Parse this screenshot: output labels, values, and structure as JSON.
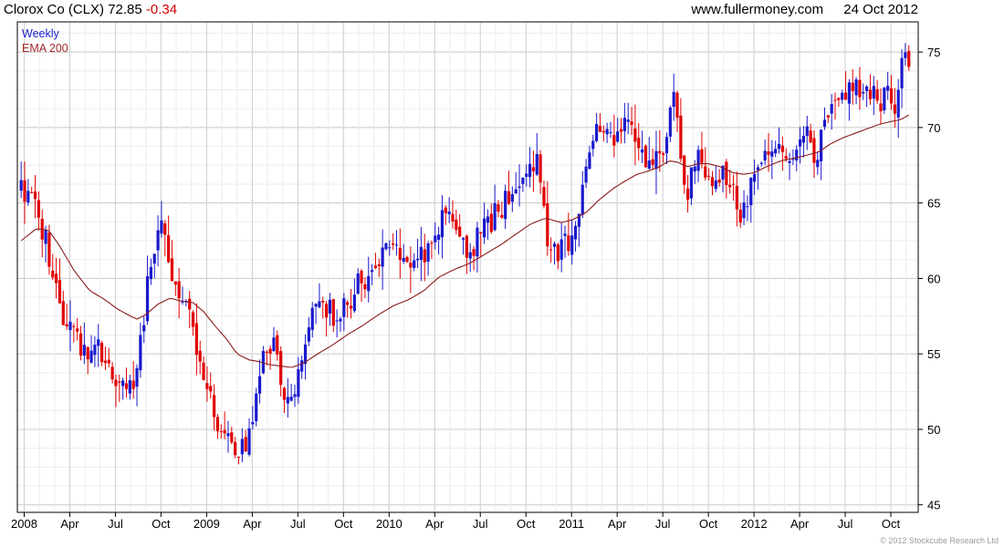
{
  "header": {
    "title": "Clorox Co (CLX) 72.85",
    "change": "-0.34",
    "site": "www.fullermoney.com",
    "date": "24 Oct 2012"
  },
  "legend": {
    "series": "Weekly",
    "indicator": "EMA 200"
  },
  "footer": {
    "copyright": "© 2012 Stockcube Research Ltd"
  },
  "colors": {
    "up": "#1a1acc",
    "down": "#e00000",
    "ema": "#8b1a1a",
    "grid": "#d8d8d8"
  },
  "chart_data": {
    "type": "candlestick",
    "title": "Clorox Co (CLX)",
    "ylim": [
      44.5,
      77
    ],
    "yticks": [
      45,
      50,
      55,
      60,
      65,
      70,
      75
    ],
    "xticks": [
      {
        "label": "2008",
        "t": 0.2
      },
      {
        "label": "Apr",
        "t": 3.2
      },
      {
        "label": "Jul",
        "t": 6.2
      },
      {
        "label": "Oct",
        "t": 9.2
      },
      {
        "label": "2009",
        "t": 12.2
      },
      {
        "label": "Apr",
        "t": 15.2
      },
      {
        "label": "Jul",
        "t": 18.2
      },
      {
        "label": "Oct",
        "t": 21.2
      },
      {
        "label": "2010",
        "t": 24.2
      },
      {
        "label": "Apr",
        "t": 27.2
      },
      {
        "label": "Jul",
        "t": 30.2
      },
      {
        "label": "Oct",
        "t": 33.2
      },
      {
        "label": "2011",
        "t": 36.2
      },
      {
        "label": "Apr",
        "t": 39.2
      },
      {
        "label": "Jul",
        "t": 42.2
      },
      {
        "label": "Oct",
        "t": 45.2
      },
      {
        "label": "2012",
        "t": 48.2
      },
      {
        "label": "Apr",
        "t": 51.2
      },
      {
        "label": "Jul",
        "t": 54.2
      },
      {
        "label": "Oct",
        "t": 57.2
      }
    ],
    "xlim": [
      -0.25,
      59.0
    ],
    "close_anchors": [
      [
        0,
        66.0
      ],
      [
        0.5,
        65.5
      ],
      [
        1,
        64.5
      ],
      [
        1.5,
        63.0
      ],
      [
        2.2,
        59.5
      ],
      [
        2.8,
        57.0
      ],
      [
        3.5,
        56.0
      ],
      [
        4.3,
        55.5
      ],
      [
        5,
        55.2
      ],
      [
        5.8,
        54.5
      ],
      [
        6.5,
        53.0
      ],
      [
        7,
        52.5
      ],
      [
        7.6,
        54.0
      ],
      [
        8.2,
        58.5
      ],
      [
        8.7,
        62.0
      ],
      [
        9.3,
        63.5
      ],
      [
        9.8,
        61.0
      ],
      [
        10.4,
        59.0
      ],
      [
        11,
        58.0
      ],
      [
        11.6,
        55.5
      ],
      [
        12.2,
        53.0
      ],
      [
        12.8,
        51.0
      ],
      [
        13.5,
        49.5
      ],
      [
        14.3,
        48.5
      ],
      [
        15,
        49.5
      ],
      [
        15.5,
        52.0
      ],
      [
        16,
        55.0
      ],
      [
        16.6,
        55.5
      ],
      [
        17.2,
        53.0
      ],
      [
        17.8,
        52.0
      ],
      [
        18.4,
        54.5
      ],
      [
        19,
        57.0
      ],
      [
        19.8,
        58.5
      ],
      [
        20.6,
        57.5
      ],
      [
        21.4,
        58.0
      ],
      [
        22,
        59.5
      ],
      [
        22.6,
        59.5
      ],
      [
        23.2,
        60.5
      ],
      [
        23.8,
        61.5
      ],
      [
        24.5,
        62.0
      ],
      [
        25.2,
        61.0
      ],
      [
        26,
        60.5
      ],
      [
        26.8,
        62.5
      ],
      [
        27.4,
        63.5
      ],
      [
        28,
        64.0
      ],
      [
        28.8,
        62.5
      ],
      [
        29.5,
        62.0
      ],
      [
        30.2,
        63.0
      ],
      [
        31,
        64.0
      ],
      [
        31.8,
        65.0
      ],
      [
        32.5,
        65.5
      ],
      [
        33.2,
        67.0
      ],
      [
        33.8,
        67.5
      ],
      [
        34.2,
        67.0
      ],
      [
        34.5,
        63.0
      ],
      [
        35,
        62.0
      ],
      [
        35.6,
        62.0
      ],
      [
        36.2,
        63.0
      ],
      [
        36.8,
        65.0
      ],
      [
        37.4,
        69.0
      ],
      [
        38,
        69.5
      ],
      [
        38.7,
        69.0
      ],
      [
        39.5,
        70.0
      ],
      [
        40.3,
        69.5
      ],
      [
        41,
        67.5
      ],
      [
        41.6,
        68.0
      ],
      [
        42.2,
        68.0
      ],
      [
        42.6,
        70.0
      ],
      [
        42.8,
        74.0
      ],
      [
        43.1,
        71.0
      ],
      [
        43.5,
        67.0
      ],
      [
        43.8,
        65.0
      ],
      [
        44.2,
        68.0
      ],
      [
        44.8,
        67.5
      ],
      [
        45.5,
        66.0
      ],
      [
        46.2,
        67.0
      ],
      [
        46.8,
        66.0
      ],
      [
        47.3,
        64.5
      ],
      [
        47.8,
        65.5
      ],
      [
        48.2,
        66.5
      ],
      [
        48.8,
        69.0
      ],
      [
        49.5,
        68.5
      ],
      [
        50.2,
        68.0
      ],
      [
        51,
        68.5
      ],
      [
        51.8,
        69.5
      ],
      [
        52.3,
        68.0
      ],
      [
        52.8,
        70.0
      ],
      [
        53.4,
        71.0
      ],
      [
        54,
        72.5
      ],
      [
        54.6,
        73.0
      ],
      [
        55.2,
        72.0
      ],
      [
        55.8,
        72.5
      ],
      [
        56.4,
        71.5
      ],
      [
        57,
        72.0
      ],
      [
        57.4,
        71.0
      ],
      [
        57.8,
        73.5
      ],
      [
        58.2,
        74.5
      ],
      [
        58.5,
        72.85
      ]
    ],
    "ema_anchors": [
      [
        0,
        62.5
      ],
      [
        1,
        63.3
      ],
      [
        1.8,
        63.2
      ],
      [
        2.5,
        62.2
      ],
      [
        3.5,
        60.5
      ],
      [
        4.5,
        59.2
      ],
      [
        5.5,
        58.6
      ],
      [
        6.3,
        58.0
      ],
      [
        7,
        57.6
      ],
      [
        7.6,
        57.3
      ],
      [
        8.2,
        57.6
      ],
      [
        9,
        58.3
      ],
      [
        9.8,
        58.7
      ],
      [
        10.5,
        58.5
      ],
      [
        11.3,
        58.4
      ],
      [
        12,
        57.8
      ],
      [
        12.8,
        56.8
      ],
      [
        13.5,
        56.0
      ],
      [
        14.2,
        55.0
      ],
      [
        15,
        54.6
      ],
      [
        15.6,
        54.5
      ],
      [
        16.3,
        54.3
      ],
      [
        17,
        54.2
      ],
      [
        17.8,
        54.1
      ],
      [
        18.6,
        54.4
      ],
      [
        19.5,
        55.0
      ],
      [
        20.5,
        55.6
      ],
      [
        21.5,
        56.3
      ],
      [
        22.5,
        56.9
      ],
      [
        23.5,
        57.6
      ],
      [
        24.5,
        58.2
      ],
      [
        25.5,
        58.6
      ],
      [
        26.5,
        59.2
      ],
      [
        27.5,
        60.1
      ],
      [
        28.5,
        60.6
      ],
      [
        29.5,
        61.0
      ],
      [
        30.5,
        61.6
      ],
      [
        31.5,
        62.2
      ],
      [
        32.5,
        62.9
      ],
      [
        33.5,
        63.6
      ],
      [
        34.5,
        64.0
      ],
      [
        35.5,
        63.7
      ],
      [
        36.3,
        63.9
      ],
      [
        37.2,
        64.4
      ],
      [
        38,
        65.2
      ],
      [
        39,
        66.0
      ],
      [
        39.8,
        66.5
      ],
      [
        40.5,
        66.9
      ],
      [
        41.2,
        67.1
      ],
      [
        42,
        67.4
      ],
      [
        42.6,
        67.8
      ],
      [
        43.2,
        67.7
      ],
      [
        43.8,
        67.4
      ],
      [
        44.5,
        67.6
      ],
      [
        45.2,
        67.6
      ],
      [
        46,
        67.4
      ],
      [
        46.8,
        67.0
      ],
      [
        47.5,
        66.9
      ],
      [
        48.2,
        67.0
      ],
      [
        49,
        67.4
      ],
      [
        50,
        67.8
      ],
      [
        51,
        68.0
      ],
      [
        51.8,
        68.2
      ],
      [
        52.5,
        68.4
      ],
      [
        53.2,
        68.9
      ],
      [
        54,
        69.3
      ],
      [
        54.8,
        69.6
      ],
      [
        55.6,
        69.9
      ],
      [
        56.4,
        70.2
      ],
      [
        57.2,
        70.4
      ],
      [
        57.8,
        70.5
      ],
      [
        58.5,
        70.9
      ]
    ]
  }
}
